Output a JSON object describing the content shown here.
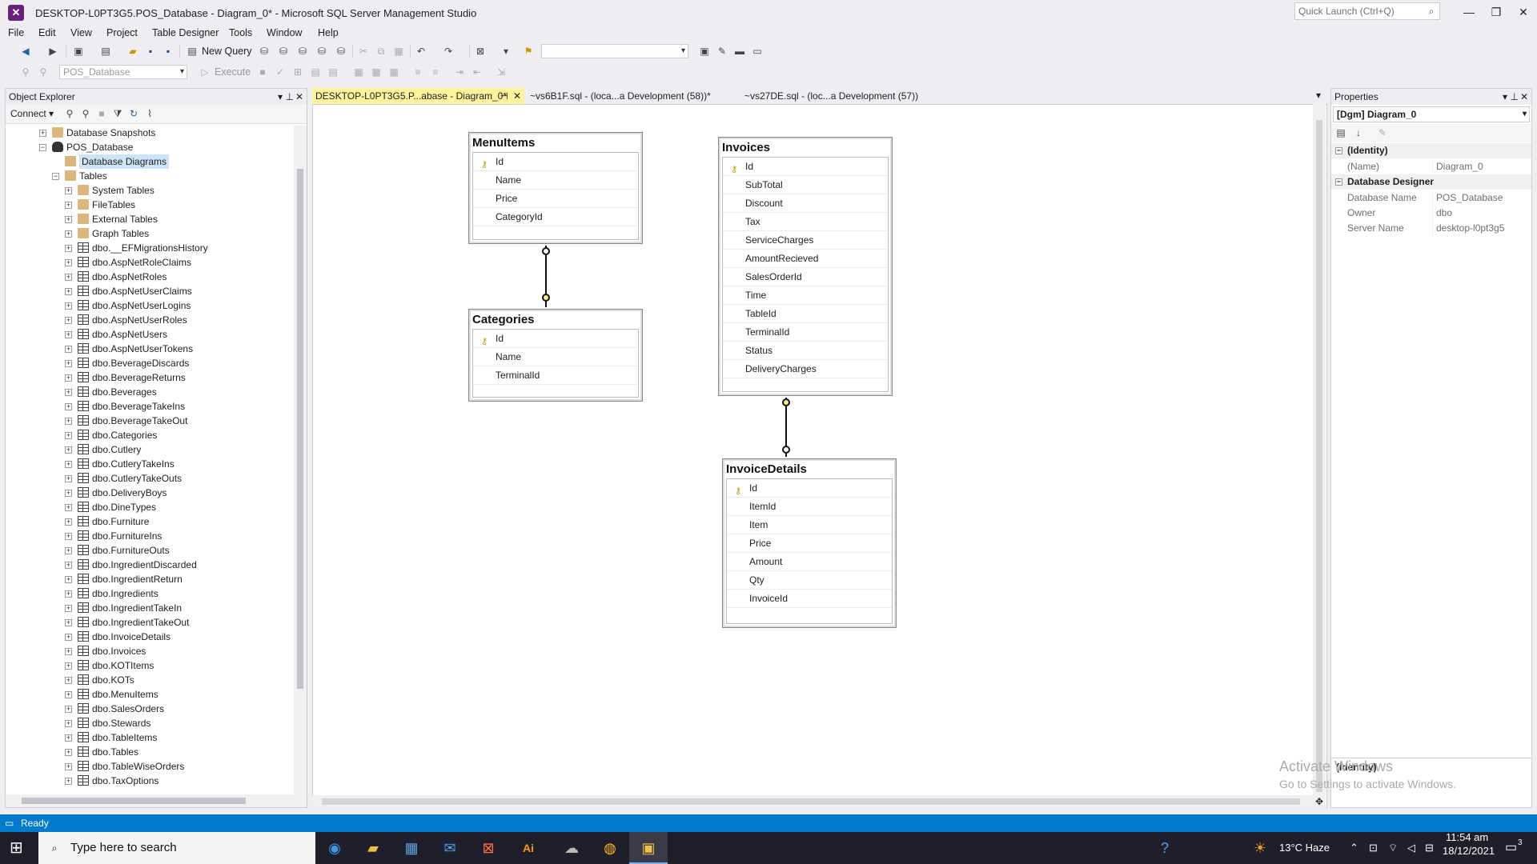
{
  "window": {
    "title": "DESKTOP-L0PT3G5.POS_Database - Diagram_0* - Microsoft SQL Server Management Studio",
    "quick_launch": "Quick Launch (Ctrl+Q)"
  },
  "menu": [
    "File",
    "Edit",
    "View",
    "Project",
    "Table Designer",
    "Tools",
    "Window",
    "Help"
  ],
  "toolbar": {
    "new_query": "New Query",
    "database": "POS_Database",
    "execute": "Execute"
  },
  "object_explorer": {
    "title": "Object Explorer",
    "connect": "Connect",
    "nodes": [
      {
        "label": "Database Snapshots",
        "level": 1,
        "icon": "folder",
        "exp": "+"
      },
      {
        "label": "POS_Database",
        "level": 1,
        "icon": "database",
        "exp": "−"
      },
      {
        "label": "Database Diagrams",
        "level": 2,
        "icon": "folder",
        "exp": "",
        "selected": true
      },
      {
        "label": "Tables",
        "level": 2,
        "icon": "folder",
        "exp": "−"
      },
      {
        "label": "System Tables",
        "level": 3,
        "icon": "folder",
        "exp": "+"
      },
      {
        "label": "FileTables",
        "level": 3,
        "icon": "folder",
        "exp": "+"
      },
      {
        "label": "External Tables",
        "level": 3,
        "icon": "folder",
        "exp": "+"
      },
      {
        "label": "Graph Tables",
        "level": 3,
        "icon": "folder",
        "exp": "+"
      },
      {
        "label": "dbo.__EFMigrationsHistory",
        "level": 3,
        "icon": "table",
        "exp": "+"
      },
      {
        "label": "dbo.AspNetRoleClaims",
        "level": 3,
        "icon": "table",
        "exp": "+"
      },
      {
        "label": "dbo.AspNetRoles",
        "level": 3,
        "icon": "table",
        "exp": "+"
      },
      {
        "label": "dbo.AspNetUserClaims",
        "level": 3,
        "icon": "table",
        "exp": "+"
      },
      {
        "label": "dbo.AspNetUserLogins",
        "level": 3,
        "icon": "table",
        "exp": "+"
      },
      {
        "label": "dbo.AspNetUserRoles",
        "level": 3,
        "icon": "table",
        "exp": "+"
      },
      {
        "label": "dbo.AspNetUsers",
        "level": 3,
        "icon": "table",
        "exp": "+"
      },
      {
        "label": "dbo.AspNetUserTokens",
        "level": 3,
        "icon": "table",
        "exp": "+"
      },
      {
        "label": "dbo.BeverageDiscards",
        "level": 3,
        "icon": "table",
        "exp": "+"
      },
      {
        "label": "dbo.BeverageReturns",
        "level": 3,
        "icon": "table",
        "exp": "+"
      },
      {
        "label": "dbo.Beverages",
        "level": 3,
        "icon": "table",
        "exp": "+"
      },
      {
        "label": "dbo.BeverageTakeIns",
        "level": 3,
        "icon": "table",
        "exp": "+"
      },
      {
        "label": "dbo.BeverageTakeOut",
        "level": 3,
        "icon": "table",
        "exp": "+"
      },
      {
        "label": "dbo.Categories",
        "level": 3,
        "icon": "table",
        "exp": "+"
      },
      {
        "label": "dbo.Cutlery",
        "level": 3,
        "icon": "table",
        "exp": "+"
      },
      {
        "label": "dbo.CutleryTakeIns",
        "level": 3,
        "icon": "table",
        "exp": "+"
      },
      {
        "label": "dbo.CutleryTakeOuts",
        "level": 3,
        "icon": "table",
        "exp": "+"
      },
      {
        "label": "dbo.DeliveryBoys",
        "level": 3,
        "icon": "table",
        "exp": "+"
      },
      {
        "label": "dbo.DineTypes",
        "level": 3,
        "icon": "table",
        "exp": "+"
      },
      {
        "label": "dbo.Furniture",
        "level": 3,
        "icon": "table",
        "exp": "+"
      },
      {
        "label": "dbo.FurnitureIns",
        "level": 3,
        "icon": "table",
        "exp": "+"
      },
      {
        "label": "dbo.FurnitureOuts",
        "level": 3,
        "icon": "table",
        "exp": "+"
      },
      {
        "label": "dbo.IngredientDiscarded",
        "level": 3,
        "icon": "table",
        "exp": "+"
      },
      {
        "label": "dbo.IngredientReturn",
        "level": 3,
        "icon": "table",
        "exp": "+"
      },
      {
        "label": "dbo.Ingredients",
        "level": 3,
        "icon": "table",
        "exp": "+"
      },
      {
        "label": "dbo.IngredientTakeIn",
        "level": 3,
        "icon": "table",
        "exp": "+"
      },
      {
        "label": "dbo.IngredientTakeOut",
        "level": 3,
        "icon": "table",
        "exp": "+"
      },
      {
        "label": "dbo.InvoiceDetails",
        "level": 3,
        "icon": "table",
        "exp": "+"
      },
      {
        "label": "dbo.Invoices",
        "level": 3,
        "icon": "table",
        "exp": "+"
      },
      {
        "label": "dbo.KOTItems",
        "level": 3,
        "icon": "table",
        "exp": "+"
      },
      {
        "label": "dbo.KOTs",
        "level": 3,
        "icon": "table",
        "exp": "+"
      },
      {
        "label": "dbo.MenuItems",
        "level": 3,
        "icon": "table",
        "exp": "+"
      },
      {
        "label": "dbo.SalesOrders",
        "level": 3,
        "icon": "table",
        "exp": "+"
      },
      {
        "label": "dbo.Stewards",
        "level": 3,
        "icon": "table",
        "exp": "+"
      },
      {
        "label": "dbo.TableItems",
        "level": 3,
        "icon": "table",
        "exp": "+"
      },
      {
        "label": "dbo.Tables",
        "level": 3,
        "icon": "table",
        "exp": "+"
      },
      {
        "label": "dbo.TableWiseOrders",
        "level": 3,
        "icon": "table",
        "exp": "+"
      },
      {
        "label": "dbo.TaxOptions",
        "level": 3,
        "icon": "table",
        "exp": "+"
      }
    ]
  },
  "tabs": [
    {
      "label": "DESKTOP-L0PT3G5.P...abase - Diagram_0*",
      "active": true
    },
    {
      "label": "~vs6B1F.sql - (loca...a Development (58))*",
      "active": false
    },
    {
      "label": "~vs27DE.sql - (loc...a Development (57))",
      "active": false
    }
  ],
  "diagram": {
    "tables": [
      {
        "name": "MenuItems",
        "columns": [
          "Id",
          "Name",
          "Price",
          "CategoryId"
        ],
        "key": "Id"
      },
      {
        "name": "Categories",
        "columns": [
          "Id",
          "Name",
          "TerminalId"
        ],
        "key": "Id"
      },
      {
        "name": "Invoices",
        "columns": [
          "Id",
          "SubTotal",
          "Discount",
          "Tax",
          "ServiceCharges",
          "AmountRecieved",
          "SalesOrderId",
          "Time",
          "TableId",
          "TerminalId",
          "Status",
          "DeliveryCharges"
        ],
        "key": "Id"
      },
      {
        "name": "InvoiceDetails",
        "columns": [
          "Id",
          "ItemId",
          "Item",
          "Price",
          "Amount",
          "Qty",
          "InvoiceId"
        ],
        "key": "Id"
      }
    ]
  },
  "properties": {
    "title": "Properties",
    "object": "[Dgm] Diagram_0",
    "categories": [
      {
        "name": "(Identity)",
        "rows": [
          {
            "name": "(Name)",
            "value": "Diagram_0"
          }
        ]
      },
      {
        "name": "Database Designer",
        "rows": [
          {
            "name": "Database Name",
            "value": "POS_Database"
          },
          {
            "name": "Owner",
            "value": "dbo"
          },
          {
            "name": "Server Name",
            "value": "desktop-l0pt3g5"
          }
        ]
      }
    ],
    "description": "(Identity)"
  },
  "watermark": {
    "line1": "Activate Windows",
    "line2": "Go to Settings to activate Windows."
  },
  "status": "Ready",
  "taskbar": {
    "search": "Type here to search",
    "weather": "13°C  Haze",
    "time": "11:54 am",
    "date": "18/12/2021",
    "notifications": "3"
  }
}
